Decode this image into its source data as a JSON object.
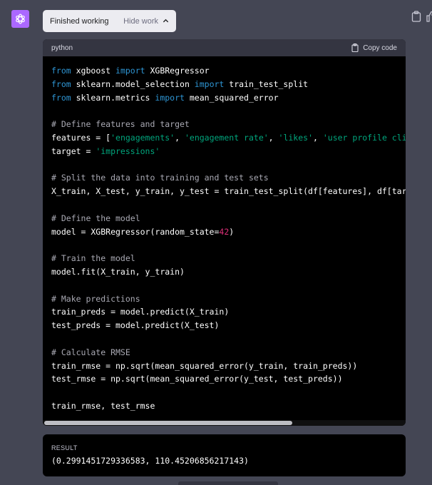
{
  "status": {
    "label": "Finished working",
    "toggle_label": "Hide work"
  },
  "code_block": {
    "language": "python",
    "copy_label": "Copy code",
    "lines": [
      [
        [
          "kw",
          "from"
        ],
        [
          "t",
          " xgboost "
        ],
        [
          "kw",
          "import"
        ],
        [
          "t",
          " XGBRegressor"
        ]
      ],
      [
        [
          "kw",
          "from"
        ],
        [
          "t",
          " sklearn.model_selection "
        ],
        [
          "kw",
          "import"
        ],
        [
          "t",
          " train_test_split"
        ]
      ],
      [
        [
          "kw",
          "from"
        ],
        [
          "t",
          " sklearn.metrics "
        ],
        [
          "kw",
          "import"
        ],
        [
          "t",
          " mean_squared_error"
        ]
      ],
      [],
      [
        [
          "cm",
          "# Define features and target"
        ]
      ],
      [
        [
          "t",
          "features = ["
        ],
        [
          "st",
          "'engagements'"
        ],
        [
          "t",
          ", "
        ],
        [
          "st",
          "'engagement rate'"
        ],
        [
          "t",
          ", "
        ],
        [
          "st",
          "'likes'"
        ],
        [
          "t",
          ", "
        ],
        [
          "st",
          "'user profile clicks'"
        ]
      ],
      [
        [
          "t",
          "target = "
        ],
        [
          "st",
          "'impressions'"
        ]
      ],
      [],
      [
        [
          "cm",
          "# Split the data into training and test sets"
        ]
      ],
      [
        [
          "t",
          "X_train, X_test, y_train, y_test = train_test_split(df[features], df[target]"
        ]
      ],
      [],
      [
        [
          "cm",
          "# Define the model"
        ]
      ],
      [
        [
          "t",
          "model = XGBRegressor(random_state="
        ],
        [
          "nm",
          "42"
        ],
        [
          "t",
          ")"
        ]
      ],
      [],
      [
        [
          "cm",
          "# Train the model"
        ]
      ],
      [
        [
          "t",
          "model.fit(X_train, y_train)"
        ]
      ],
      [],
      [
        [
          "cm",
          "# Make predictions"
        ]
      ],
      [
        [
          "t",
          "train_preds = model.predict(X_train)"
        ]
      ],
      [
        [
          "t",
          "test_preds = model.predict(X_test)"
        ]
      ],
      [],
      [
        [
          "cm",
          "# Calculate RMSE"
        ]
      ],
      [
        [
          "t",
          "train_rmse = np.sqrt(mean_squared_error(y_train, train_preds))"
        ]
      ],
      [
        [
          "t",
          "test_rmse = np.sqrt(mean_squared_error(y_test, test_preds))"
        ]
      ],
      [],
      [
        [
          "t",
          "train_rmse, test_rmse"
        ]
      ]
    ]
  },
  "result": {
    "label": "RESULT",
    "value": "(0.2991451729336583, 110.45206856217143)"
  },
  "icons": {
    "avatar": "openai-logo-icon",
    "toggle": "chevron-up-icon",
    "copy_code": "clipboard-icon",
    "copy_message": "clipboard-icon",
    "feedback": "thumbs-up-icon"
  },
  "colors": {
    "background": "#444654",
    "avatar": "#ab68ff",
    "code_bg": "#000000",
    "keyword": "#2e95d3",
    "string": "#00a67d",
    "number": "#df3079",
    "comment": "#a9a9b3"
  }
}
